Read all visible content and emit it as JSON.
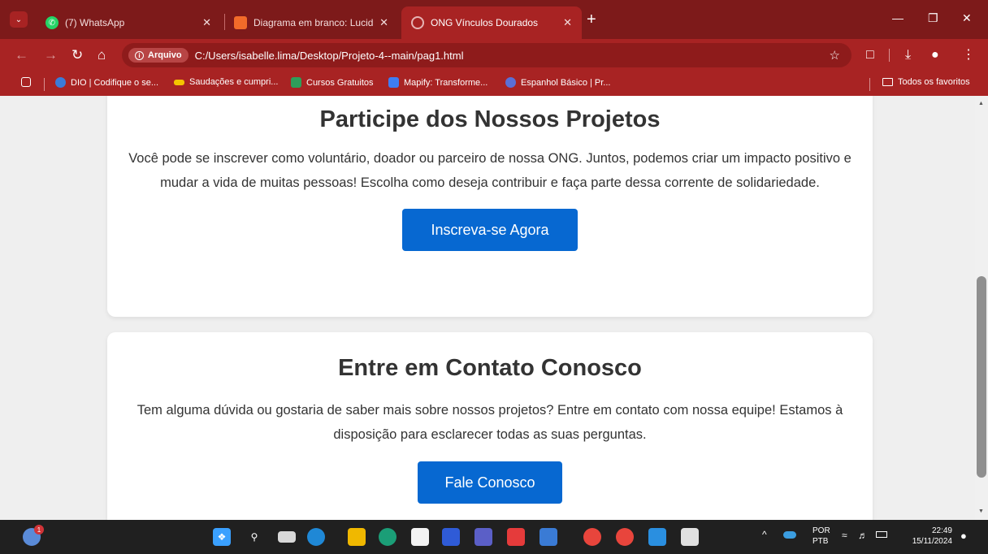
{
  "browser": {
    "tabs": [
      {
        "title": "(7) WhatsApp",
        "icon": "whatsapp-icon",
        "color": "#25d366",
        "active": false
      },
      {
        "title": "Diagrama em branco: Lucidchar",
        "icon": "lucidchart-icon",
        "color": "#f26b2a",
        "active": false
      },
      {
        "title": "ONG Vínculos Dourados",
        "icon": "globe-icon",
        "color": "#e6b3b3",
        "active": true
      }
    ],
    "address": {
      "chip_label": "Arquivo",
      "url": "C:/Users/isabelle.lima/Desktop/Projeto-4--main/pag1.html"
    },
    "bookmarks": [
      {
        "label": "DIO | Codifique o se...",
        "icon": "dio-icon",
        "color": "#3b7bd8"
      },
      {
        "label": "Saudações e cumpri...",
        "icon": "flag-icon",
        "color": "#f5c400"
      },
      {
        "label": "Cursos Gratuitos",
        "icon": "courses-icon",
        "color": "#2e9e5a"
      },
      {
        "label": "Mapify: Transforme...",
        "icon": "mapify-icon",
        "color": "#3f7df4"
      },
      {
        "label": "Espanhol Básico | Pr...",
        "icon": "spanish-icon",
        "color": "#5b6fd6"
      }
    ],
    "all_bookmarks_label": "Todos os favoritos"
  },
  "page": {
    "section1": {
      "title": "Participe dos Nossos Projetos",
      "text": "Você pode se inscrever como voluntário, doador ou parceiro de nossa ONG. Juntos, podemos criar um impacto positivo e mudar a vida de muitas pessoas! Escolha como deseja contribuir e faça parte dessa corrente de solidariedade.",
      "button": "Inscreva-se Agora"
    },
    "section2": {
      "title": "Entre em Contato Conosco",
      "text": "Tem alguma dúvida ou gostaria de saber mais sobre nossos projetos? Entre em contato com nossa equipe! Estamos à disposição para esclarecer todas as suas perguntas.",
      "button": "Fale Conosco"
    },
    "accent_color": "#0768d1"
  },
  "taskbar": {
    "weather_badge": "1",
    "lang_top": "POR",
    "lang_bottom": "PTB",
    "time": "22:49",
    "date": "15/11/2024"
  }
}
